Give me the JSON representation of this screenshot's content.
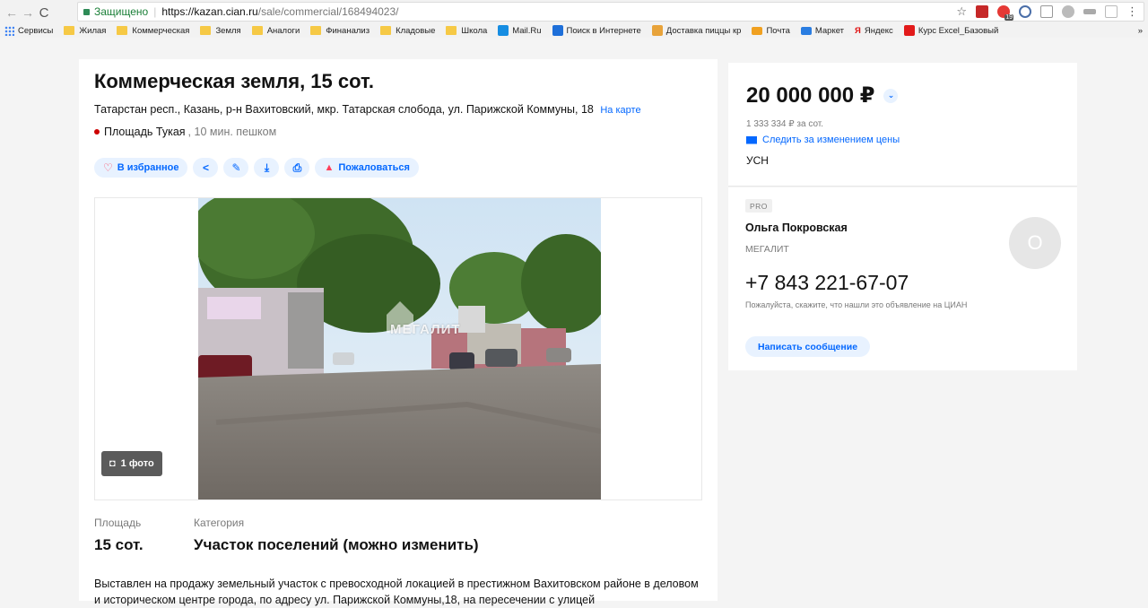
{
  "browser": {
    "back_icon": "←",
    "forward_icon": "→",
    "reload_icon": "C",
    "secure_label": "Защищено",
    "url_host": "https://kazan.cian.ru",
    "url_path": "/sale/commercial/168494023/",
    "bookmarks": [
      "Сервисы",
      "Жилая",
      "Коммерческая",
      "Земля",
      "Аналоги",
      "Финанализ",
      "Кладовые",
      "Школа",
      "Mail.Ru",
      "Поиск в Интернете",
      "Доставка пиццы кр",
      "Почта",
      "Маркет",
      "Яндекс",
      "Курс Excel_Базовый"
    ],
    "bookmarks_overflow": "»",
    "extension_badge": "19"
  },
  "listing": {
    "title": "Коммерческая земля, 15 сот.",
    "address": "Татарстан респ., Казань, р-н Вахитовский, мкр. Татарская слобода, ул. Парижской Коммуны, 18",
    "map_link": "На карте",
    "metro_name": "Площадь Тукая",
    "metro_time": ", 10 мин. пешком",
    "metro_color": "#cd0000",
    "actions": {
      "favorite": "В избранное",
      "share_icon": "<",
      "edit_icon": "✎",
      "download_icon": "⤓",
      "print_icon": "⎙",
      "complain": "Пожаловаться"
    },
    "photo_count": "1 фото",
    "watermark": "МЕГАЛИТ",
    "specs": [
      {
        "label": "Площадь",
        "value": "15 сот."
      },
      {
        "label": "Категория",
        "value": "Участок поселений (можно изменить)"
      }
    ],
    "description": "Выставлен на продажу земельный участок с превосходной локацией в престижном Вахитовском районе в деловом и историческом центре города, по адресу ул. Парижской Коммуны,18, на пересечении с улицей"
  },
  "price_card": {
    "price": "20 000 000 ₽",
    "per_unit": "1 333 334 ₽ за сот.",
    "subscribe": "Следить за изменением цены",
    "tax": "УСН"
  },
  "agent": {
    "badge": "PRO",
    "name": "Ольга Покровская",
    "agency": "МЕГАЛИТ",
    "avatar_letter": "О",
    "phone": "+7 843 221-67-07",
    "note": "Пожалуйста, скажите, что нашли это объявление на ЦИАН",
    "message_button": "Написать сообщение"
  },
  "accent_color": "#0468ff"
}
